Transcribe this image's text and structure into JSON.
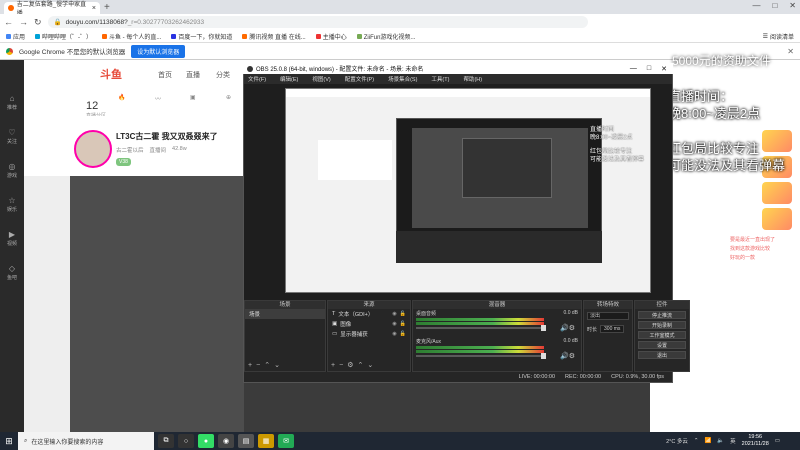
{
  "browser": {
    "tab_title": "吉二复伍套路_慢学申家直播",
    "url_host": "douyu.com/1138068?",
    "url_query": "_r=0.30277703262462933",
    "bookmarks": [
      "应用",
      "哔哩哔哩（゜-゜）",
      "斗鱼 - 每个人的直...",
      "百度一下，你就知道",
      "腾讯视频 直播 在线...",
      "主播中心",
      "ZiiFun游戏化视频..."
    ],
    "read_list": "阅读清单",
    "infobar_text": "Google Chrome 不是您的默认浏览器",
    "infobar_button": "设为默认浏览器"
  },
  "douyu": {
    "logo": "斗鱼",
    "nav": [
      "首页",
      "直播",
      "分类"
    ],
    "room_count": "12",
    "room_count_sub": "直播分区",
    "room_title": "LT3C古二霍 我又双叒叕来了",
    "room_meta": [
      "古二霍以后",
      "直播间",
      "42.8w"
    ],
    "level": "V38",
    "rail_items": [
      "推荐",
      "关注",
      "游戏",
      "娱乐",
      "视频",
      "鱼吧"
    ]
  },
  "overlay": {
    "top_text": "5000元的资助文件",
    "line1": "直播时间：",
    "line2": "晚8:00~凌晨2点",
    "line3": "红包局比较专注",
    "line4": "可能没法及其看弹幕",
    "side_chat": [
      "要是最近一直出现了",
      "找到这款游戏比较",
      "好玩的一款"
    ]
  },
  "obs": {
    "title": "OBS 25.0.8 (64-bit, windows) - 配置文件: 未命名 - 场景: 未命名",
    "menu": [
      "文件(F)",
      "编辑(E)",
      "视图(V)",
      "配置文件(P)",
      "场景集合(S)",
      "工具(T)",
      "帮助(H)"
    ],
    "docks": {
      "scenes": "场景",
      "sources": "来源",
      "mixer": "混音器",
      "transitions": "转场特效",
      "controls": "控件"
    },
    "scenes": [
      "场景"
    ],
    "sources": [
      {
        "icon": "T",
        "label": "文本（GDI+）"
      },
      {
        "icon": "▣",
        "label": "图像"
      },
      {
        "icon": "▭",
        "label": "显示器捕获"
      }
    ],
    "mixer": [
      {
        "name": "桌面音频",
        "db": "0.0 dB"
      },
      {
        "name": "麦克风/Aux",
        "db": "0.0 dB"
      }
    ],
    "transition_type": "淡出",
    "duration_label": "时长",
    "duration_value": "300 ms",
    "controls": [
      "停止推流",
      "开始录制",
      "工作室模式",
      "设置",
      "退出"
    ],
    "status": [
      "LIVE: 00:00:00",
      "REC: 00:00:00",
      "CPU: 0.9%, 30.00 fps"
    ],
    "preview_text": [
      "直播时间",
      "晚8:00~凌晨2点",
      "红包局比较专注",
      "可能没法及其看弹幕"
    ]
  },
  "taskbar": {
    "search_placeholder": "在这里输入你要搜索的内容",
    "weather": "2°C 多云",
    "ime": "英",
    "time": "19:56",
    "date": "2021/11/28"
  }
}
